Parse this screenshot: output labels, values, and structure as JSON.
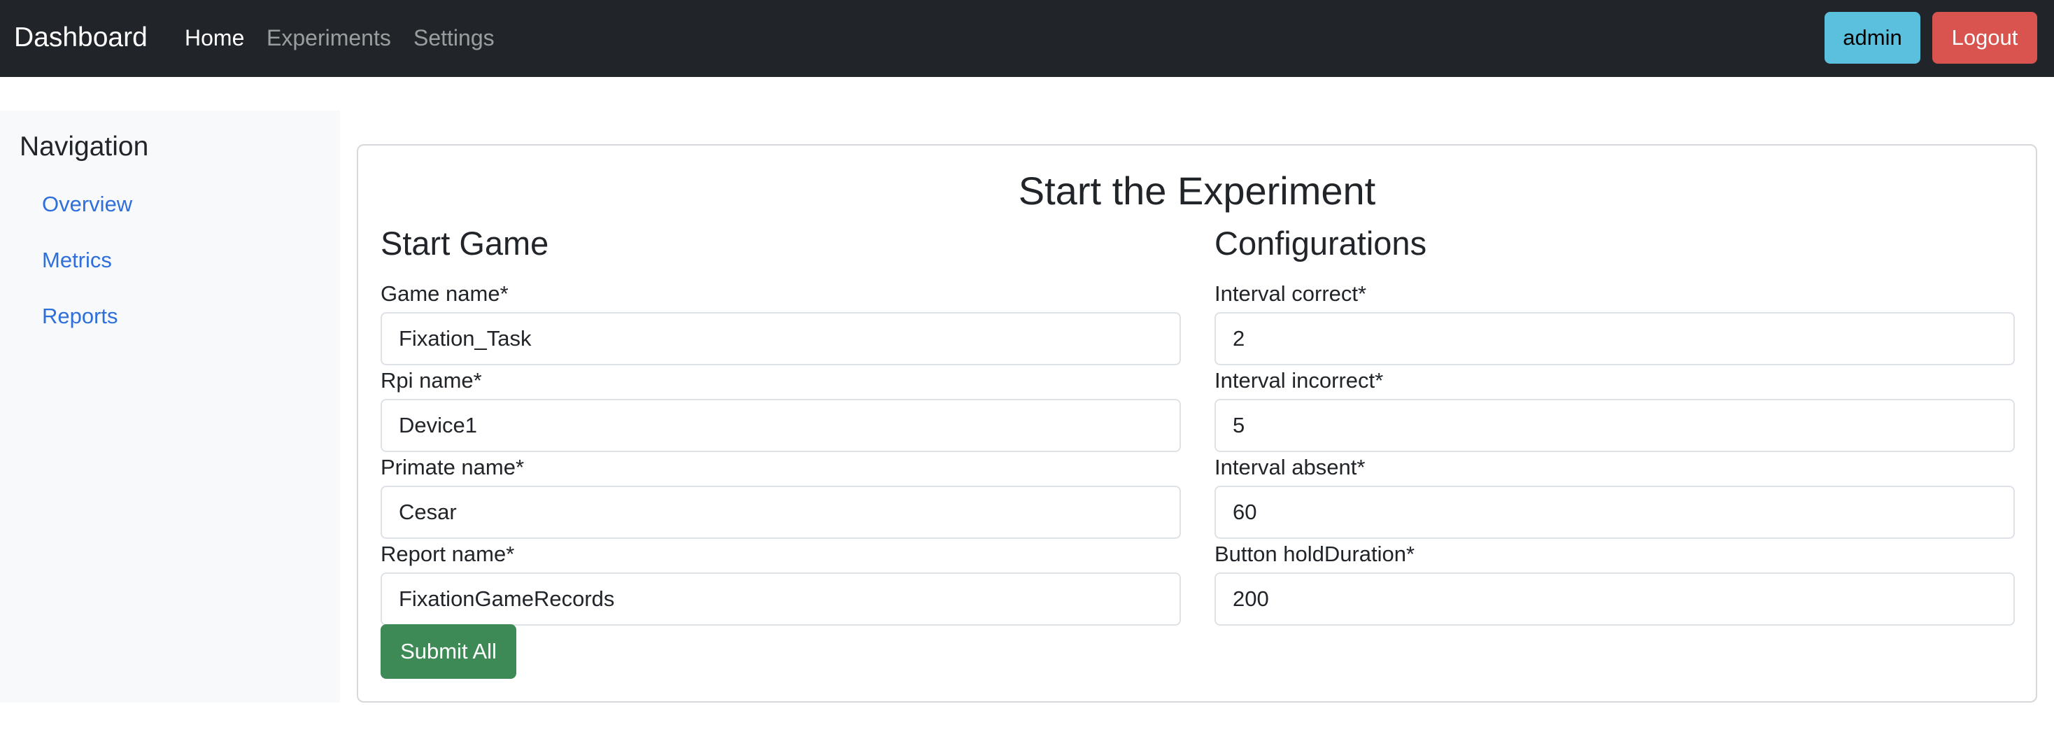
{
  "navbar": {
    "brand": "Dashboard",
    "links": [
      {
        "label": "Home",
        "active": true
      },
      {
        "label": "Experiments",
        "active": false
      },
      {
        "label": "Settings",
        "active": false
      }
    ],
    "user_button": "admin",
    "logout_button": "Logout"
  },
  "sidebar": {
    "title": "Navigation",
    "items": [
      {
        "label": "Overview"
      },
      {
        "label": "Metrics"
      },
      {
        "label": "Reports"
      }
    ]
  },
  "main": {
    "title": "Start the Experiment",
    "start_game": {
      "heading": "Start Game",
      "fields": [
        {
          "label": "Game name*",
          "value": "Fixation_Task"
        },
        {
          "label": "Rpi name*",
          "value": "Device1"
        },
        {
          "label": "Primate name*",
          "value": "Cesar"
        },
        {
          "label": "Report name*",
          "value": "FixationGameRecords"
        }
      ],
      "submit_label": "Submit All"
    },
    "configurations": {
      "heading": "Configurations",
      "fields": [
        {
          "label": "Interval correct*",
          "value": "2"
        },
        {
          "label": "Interval incorrect*",
          "value": "5"
        },
        {
          "label": "Interval absent*",
          "value": "60"
        },
        {
          "label": "Button holdDuration*",
          "value": "200"
        }
      ]
    }
  },
  "colors": {
    "navbar_bg": "#212529",
    "admin_button": "#5bc0de",
    "logout_button": "#d9534f",
    "submit_button": "#3e8a57",
    "link": "#2f6fdb",
    "sidebar_bg": "#f8f9fa"
  }
}
